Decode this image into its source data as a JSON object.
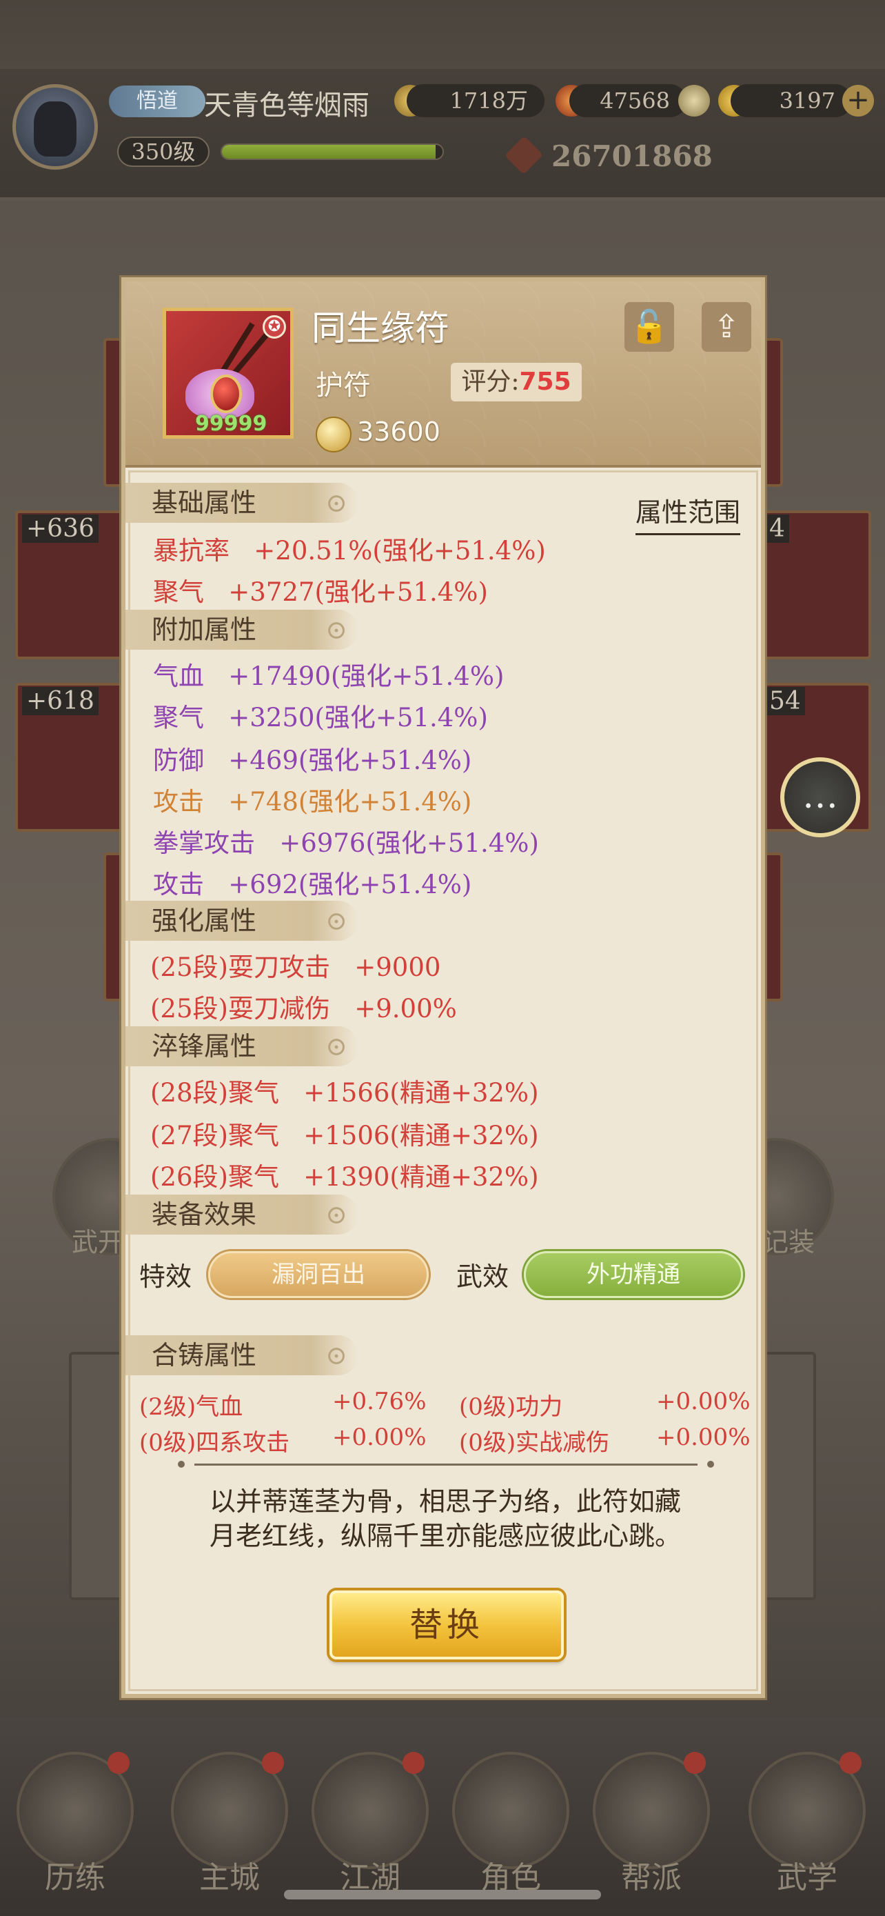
{
  "player": {
    "rank_badge": "悟道",
    "name": "天青色等烟雨",
    "silver": "1718万",
    "resource_2": "47568",
    "gold": "3197",
    "level": "350级",
    "exp_progress": 0.97,
    "power": "26701868"
  },
  "background_cards": {
    "left_1": "+636",
    "left_2": "+618",
    "right_1": "4",
    "right_2": "54"
  },
  "side_labels": {
    "left": "武开",
    "right": "记装"
  },
  "item": {
    "name": "同生缘符",
    "type": "护符",
    "score_label": "评分:",
    "score_value": "755",
    "count": "99999",
    "price": "33600",
    "star_badge": "✪"
  },
  "sections": {
    "base": "基础属性",
    "extra": "附加属性",
    "enhance": "强化属性",
    "temper": "淬锋属性",
    "effect": "装备效果",
    "cast": "合铸属性"
  },
  "attr_range_link": "属性范围",
  "base_attrs": [
    {
      "name": "暴抗率",
      "value": "+20.51%(强化+51.4%)"
    },
    {
      "name": "聚气",
      "value": "+3727(强化+51.4%)"
    }
  ],
  "extra_attrs": [
    {
      "name": "气血",
      "value": "+17490(强化+51.4%)"
    },
    {
      "name": "聚气",
      "value": "+3250(强化+51.4%)"
    },
    {
      "name": "防御",
      "value": "+469(强化+51.4%)"
    },
    {
      "name": "攻击",
      "value": "+748(强化+51.4%)"
    },
    {
      "name": "拳掌攻击",
      "value": "+6976(强化+51.4%)"
    },
    {
      "name": "攻击",
      "value": "+692(强化+51.4%)"
    }
  ],
  "enhance_attrs": [
    {
      "name": "(25段)耍刀攻击",
      "value": "+9000"
    },
    {
      "name": "(25段)耍刀减伤",
      "value": "+9.00%"
    }
  ],
  "temper_attrs": [
    {
      "name": "(28段)聚气",
      "value": "+1566(精通+32%)"
    },
    {
      "name": "(27段)聚气",
      "value": "+1506(精通+32%)"
    },
    {
      "name": "(26段)聚气",
      "value": "+1390(精通+32%)"
    }
  ],
  "effects": {
    "special_label": "特效",
    "special_value": "漏洞百出",
    "martial_label": "武效",
    "martial_value": "外功精通"
  },
  "cast_attrs": [
    {
      "name": "(2级)气血",
      "value": "+0.76%"
    },
    {
      "name": "(0级)功力",
      "value": "+0.00%"
    },
    {
      "name": "(0级)四系攻击",
      "value": "+0.00%"
    },
    {
      "name": "(0级)实战减伤",
      "value": "+0.00%"
    }
  ],
  "description_1": "以并蒂莲茎为骨，相思子为络，此符如藏",
  "description_2": "月老红线，纵隔千里亦能感应彼此心跳。",
  "replace_button": "替换",
  "bottom_nav": [
    "历练",
    "主城",
    "江湖",
    "角色",
    "帮派",
    "武学"
  ],
  "colors": {
    "red_attr": "#d2403a",
    "purple_attr": "#8e44b0",
    "orange_attr": "#d08236",
    "score": "#e23d3d",
    "effect_gold": "#d7a861",
    "effect_green": "#86b03e"
  },
  "icons": [
    "silver-coin-icon",
    "fire-icon",
    "gold-ingot-icon",
    "plus-icon",
    "lock-icon",
    "share-icon",
    "coin-icon",
    "chat-icon"
  ]
}
